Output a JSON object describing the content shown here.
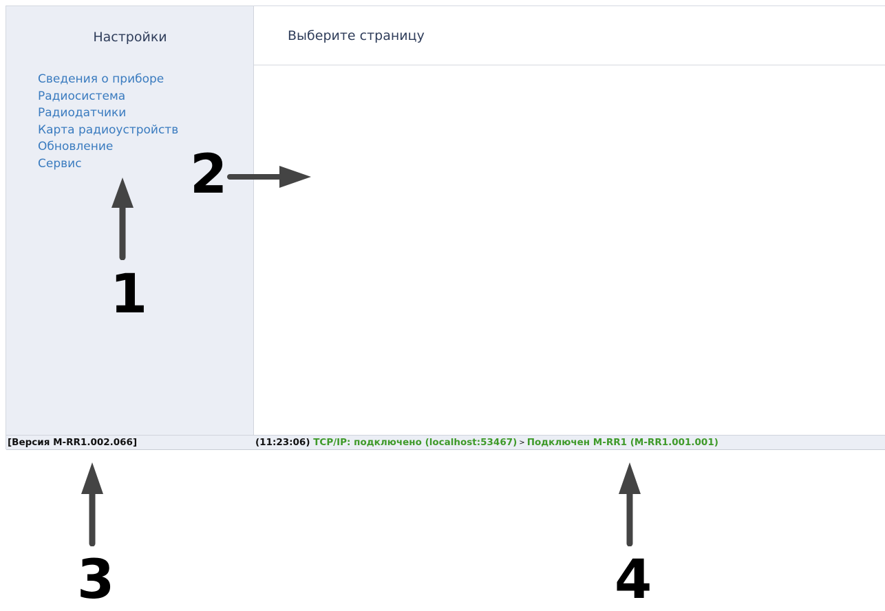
{
  "sidebar": {
    "title": "Настройки",
    "items": [
      {
        "label": "Сведения о приборе"
      },
      {
        "label": "Радиосистема"
      },
      {
        "label": "Радиодатчики"
      },
      {
        "label": "Карта радиоустройств"
      },
      {
        "label": "Обновление"
      },
      {
        "label": "Сервис"
      }
    ]
  },
  "main": {
    "title": "Выберите страницу"
  },
  "status_bar": {
    "version": "[Версия M-RR1.002.066]",
    "time": "(11:23:06)",
    "connection": "TCP/IP: подключено (localhost:53467)",
    "separator": ">",
    "device": "Подключен M-RR1 (M-RR1.001.001)"
  },
  "annotations": {
    "labels": [
      "1",
      "2",
      "3",
      "4"
    ]
  },
  "colors": {
    "sidebar_bg": "#ebeef5",
    "link": "#3a7bbf",
    "title_text": "#2f3d5a",
    "status_green": "#3f9a2a",
    "arrow": "#444444"
  }
}
